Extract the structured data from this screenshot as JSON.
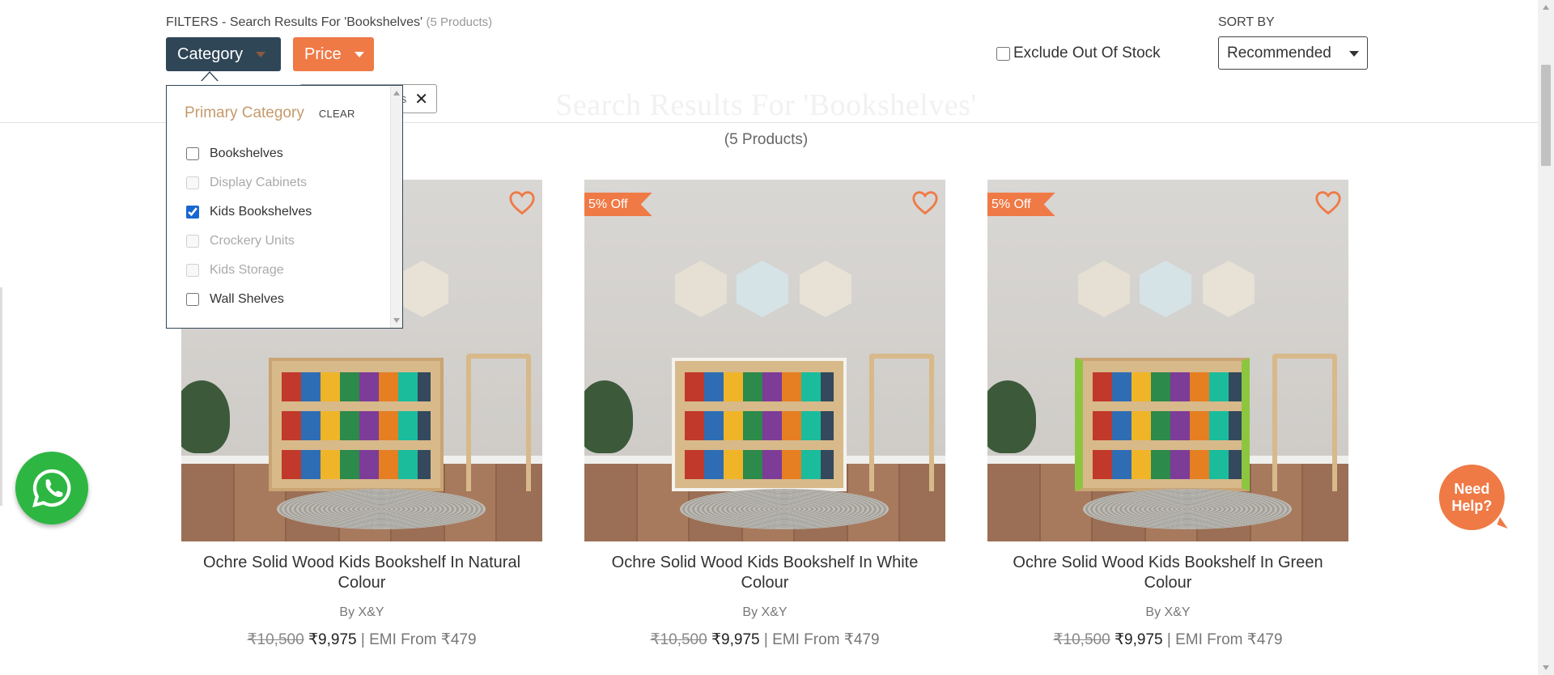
{
  "filters": {
    "heading": "FILTERS - Search Results For 'Bookshelves'",
    "heading_count": "(5 Products)",
    "category_label": "Category",
    "price_label": "Price",
    "exclude_out_of_stock_label": "Exclude Out Of Stock",
    "exclude_out_of_stock_checked": false,
    "applied_chip_text": "s"
  },
  "sort": {
    "label": "SORT BY",
    "value": "Recommended"
  },
  "results": {
    "title": "Search Results For 'Bookshelves'",
    "count": "(5 Products)"
  },
  "category_dropdown": {
    "title": "Primary Category",
    "clear_label": "CLEAR",
    "options": [
      {
        "label": "Bookshelves",
        "checked": false,
        "disabled": false
      },
      {
        "label": "Display Cabinets",
        "checked": false,
        "disabled": true
      },
      {
        "label": "Kids Bookshelves",
        "checked": true,
        "disabled": false
      },
      {
        "label": "Crockery Units",
        "checked": false,
        "disabled": true
      },
      {
        "label": "Kids Storage",
        "checked": false,
        "disabled": true
      },
      {
        "label": "Wall Shelves",
        "checked": false,
        "disabled": false
      }
    ]
  },
  "products": [
    {
      "badge": "",
      "name": "Ochre Solid Wood Kids Bookshelf In Natural Colour",
      "brand": "By X&Y",
      "mrp": "₹10,500",
      "price": "₹9,975",
      "emi": "| EMI From ₹479",
      "variant": "natural"
    },
    {
      "badge": "5% Off",
      "name": "Ochre Solid Wood Kids Bookshelf In White Colour",
      "brand": "By X&Y",
      "mrp": "₹10,500",
      "price": "₹9,975",
      "emi": "| EMI From ₹479",
      "variant": "white"
    },
    {
      "badge": "5% Off",
      "name": "Ochre Solid Wood Kids Bookshelf In Green Colour",
      "brand": "By X&Y",
      "mrp": "₹10,500",
      "price": "₹9,975",
      "emi": "| EMI From ₹479",
      "variant": "green"
    }
  ],
  "floating": {
    "need_help": "Need Help?",
    "whatsapp_icon": "whatsapp-icon"
  },
  "colors": {
    "accent_orange": "#ef7a46",
    "category_dark": "#2f4657",
    "dropdown_title": "#c49a6c",
    "whatsapp_green": "#2db742"
  }
}
